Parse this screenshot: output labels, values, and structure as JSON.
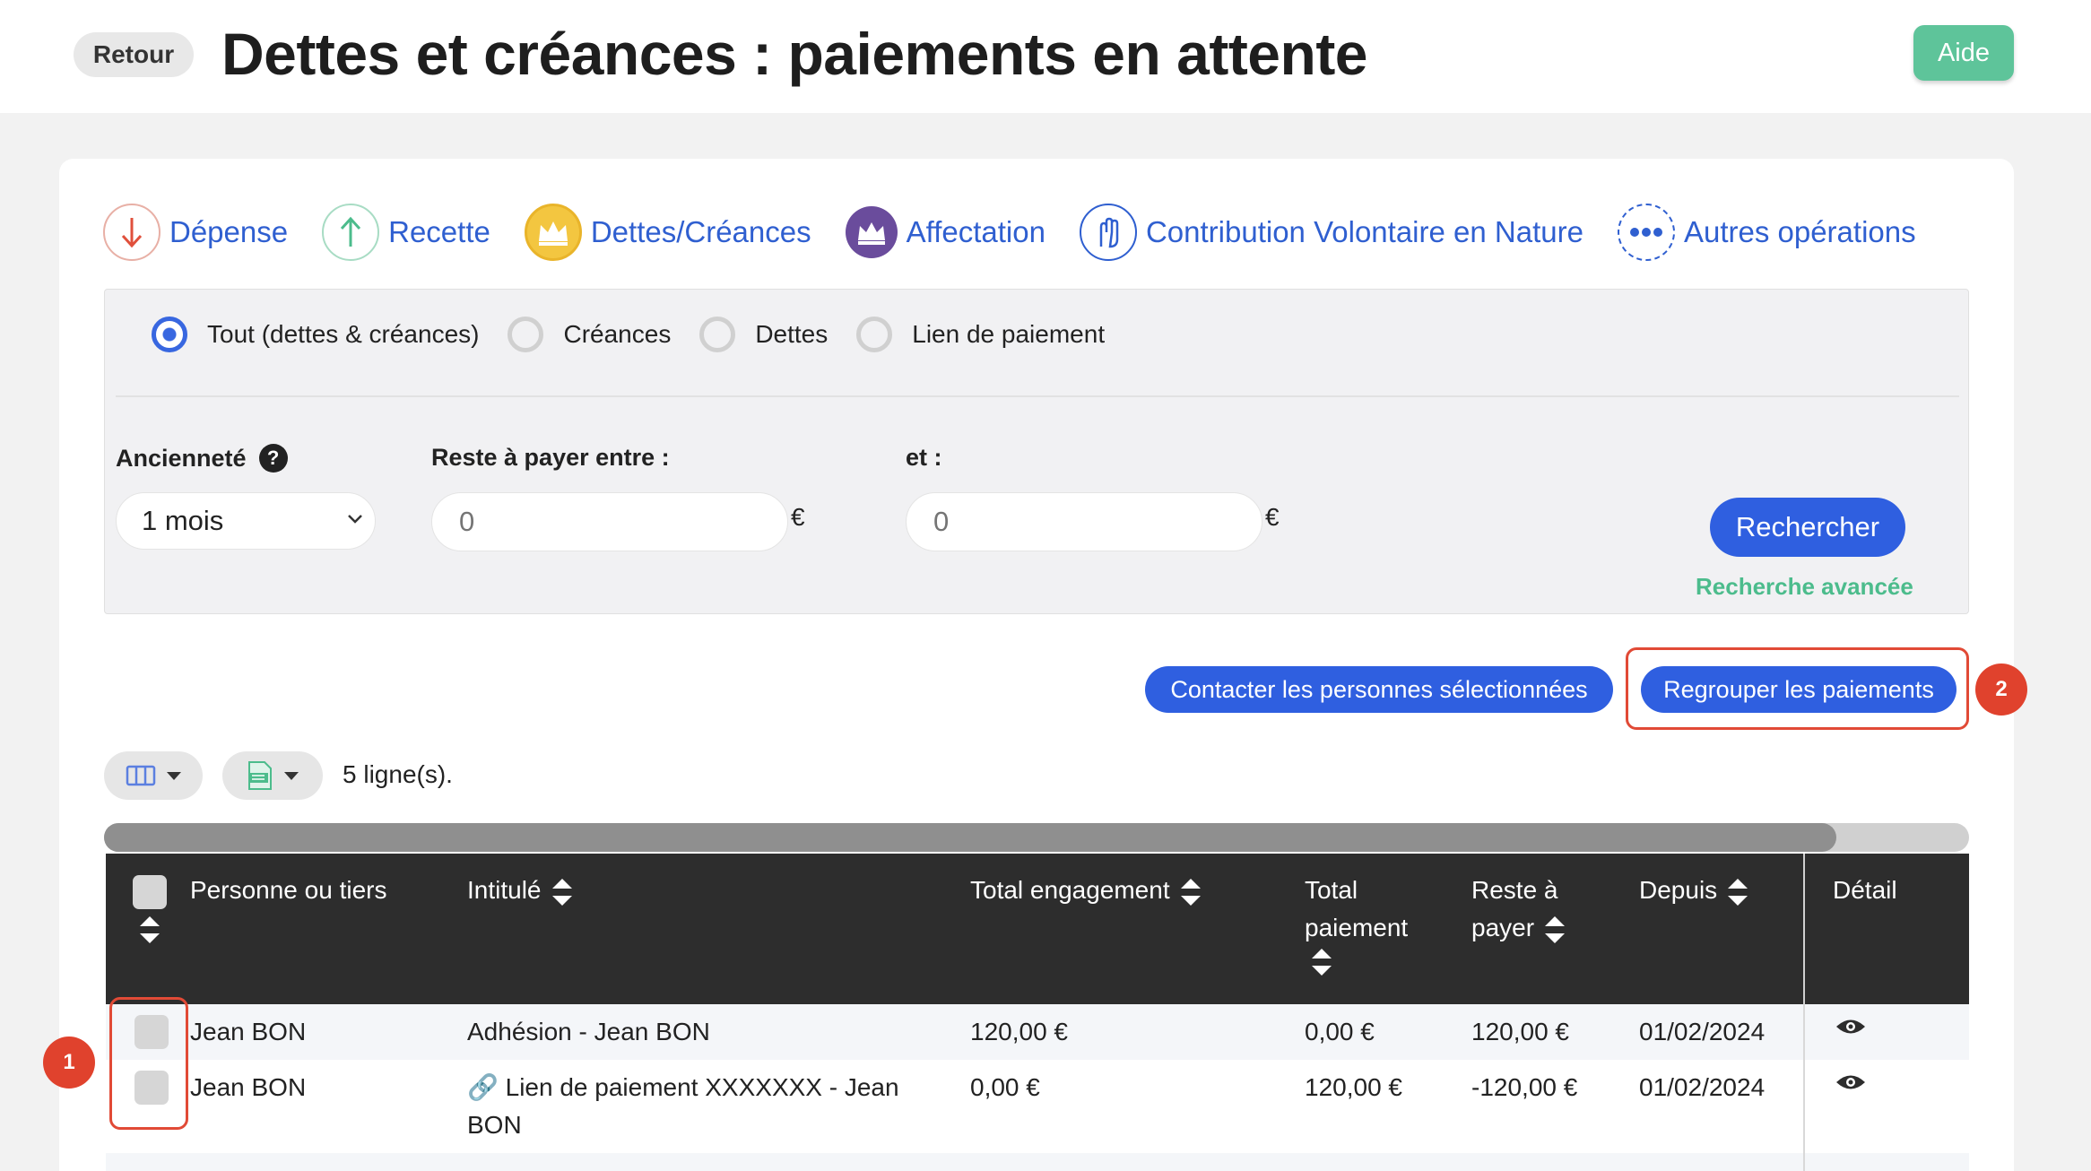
{
  "header": {
    "back_label": "Retour",
    "title": "Dettes et créances : paiements en attente",
    "help_label": "Aide"
  },
  "operation_tabs": [
    {
      "label": "Dépense",
      "icon": "arrow-down-icon",
      "color": "#e0503c"
    },
    {
      "label": "Recette",
      "icon": "arrow-up-icon",
      "color": "#4cbc8c"
    },
    {
      "label": "Dettes/Créances",
      "icon": "crown-icon",
      "color": "#e9b42a"
    },
    {
      "label": "Affectation",
      "icon": "crown-arrows-icon",
      "color": "#6a4c9c"
    },
    {
      "label": "Contribution Volontaire en Nature",
      "icon": "hand-icon",
      "color": "#2f5fd0"
    },
    {
      "label": "Autres opérations",
      "icon": "more-dots-icon",
      "color": "#2f5fd0"
    }
  ],
  "filters": {
    "types": [
      {
        "label": "Tout (dettes & créances)",
        "selected": true
      },
      {
        "label": "Créances",
        "selected": false
      },
      {
        "label": "Dettes",
        "selected": false
      },
      {
        "label": "Lien de paiement",
        "selected": false
      }
    ],
    "age_label": "Ancienneté",
    "age_value": "1 mois",
    "min_label": "Reste à payer entre :",
    "min_placeholder": "0",
    "max_label": "et :",
    "max_placeholder": "0",
    "currency": "€",
    "search_label": "Rechercher",
    "advanced_label": "Recherche avancée"
  },
  "actions": {
    "contact_label": "Contacter les personnes sélectionnées",
    "group_label": "Regrouper les paiements"
  },
  "markers": {
    "one": "1",
    "two": "2"
  },
  "table": {
    "row_count": "5 ligne(s).",
    "columns": {
      "person": "Personne ou tiers",
      "label": "Intitulé",
      "total_commit": "Total engagement",
      "total_pay_1": "Total",
      "total_pay_2": "paiement",
      "rest_1": "Reste à",
      "rest_2": "payer",
      "since": "Depuis",
      "detail": "Détail"
    },
    "rows": [
      {
        "person": "Jean BON",
        "label": "Adhésion - Jean BON",
        "total_commit": "120,00 €",
        "total_pay": "0,00 €",
        "rest": "120,00 €",
        "since": "01/02/2024"
      },
      {
        "person": "Jean BON",
        "label_line1": "🔗 Lien de paiement XXXXXXX - Jean",
        "label_line2": "BON",
        "total_commit": "0,00 €",
        "total_pay": "120,00 €",
        "rest": "-120,00 €",
        "since": "01/02/2024"
      }
    ]
  },
  "colors": {
    "accent": "#2f5fe0",
    "success": "#4cbc8c",
    "highlight": "#e14a36",
    "table_header": "#2d2d2d"
  }
}
